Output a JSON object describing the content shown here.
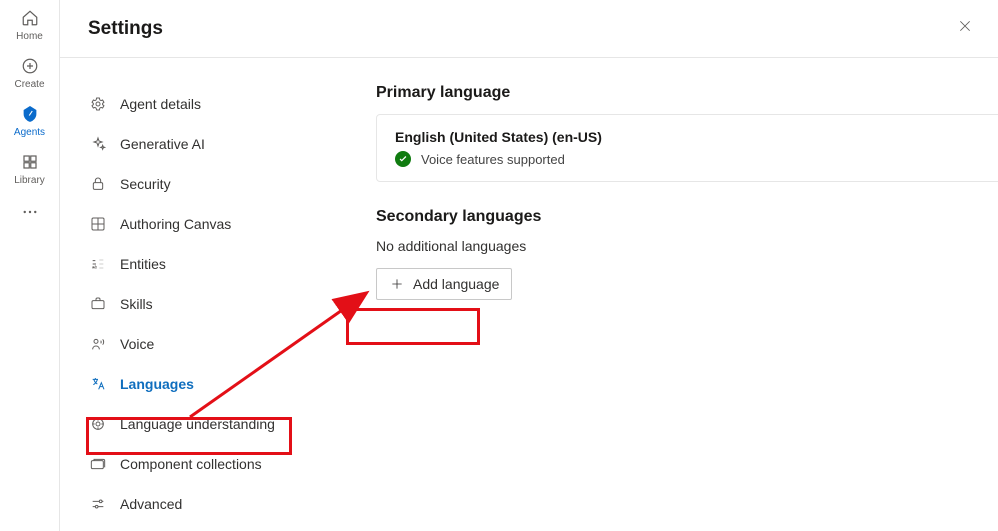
{
  "rail": {
    "items": [
      {
        "label": "Home"
      },
      {
        "label": "Create"
      },
      {
        "label": "Agents"
      },
      {
        "label": "Library"
      }
    ]
  },
  "header": {
    "title": "Settings"
  },
  "sidebar": {
    "items": [
      {
        "label": "Agent details"
      },
      {
        "label": "Generative AI"
      },
      {
        "label": "Security"
      },
      {
        "label": "Authoring Canvas"
      },
      {
        "label": "Entities"
      },
      {
        "label": "Skills"
      },
      {
        "label": "Voice"
      },
      {
        "label": "Languages"
      },
      {
        "label": "Language understanding"
      },
      {
        "label": "Component collections"
      },
      {
        "label": "Advanced"
      }
    ]
  },
  "primary": {
    "heading": "Primary language",
    "name": "English (United States) (en-US)",
    "status": "Voice features supported"
  },
  "secondary": {
    "heading": "Secondary languages",
    "empty_msg": "No additional languages",
    "add_label": "Add language"
  }
}
